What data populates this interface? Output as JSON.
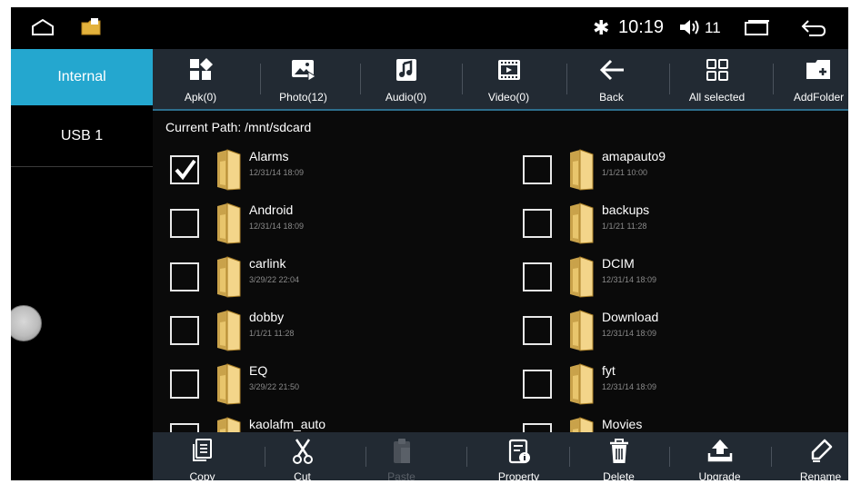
{
  "status_bar": {
    "bluetooth_icon": "bluetooth-icon",
    "time": "10:19",
    "volume_icon": "volume-icon",
    "volume_level": "11",
    "colors": {
      "background": "#000000",
      "text": "#ffffff"
    }
  },
  "sidebar": {
    "items": [
      {
        "label": "Internal",
        "selected": true
      },
      {
        "label": "USB 1",
        "selected": false
      }
    ],
    "accent": "#24a7cf"
  },
  "toolbar": {
    "buttons": [
      {
        "label": "Apk(0)",
        "icon": "apk-icon"
      },
      {
        "label": "Photo(12)",
        "icon": "photo-icon"
      },
      {
        "label": "Audio(0)",
        "icon": "audio-icon"
      },
      {
        "label": "Video(0)",
        "icon": "video-icon"
      },
      {
        "label": "Back",
        "icon": "back-arrow-icon"
      },
      {
        "label": "All selected",
        "icon": "select-all-icon"
      },
      {
        "label": "AddFolder",
        "icon": "add-folder-icon"
      }
    ],
    "background": "#222a33"
  },
  "current_path": "Current Path: /mnt/sdcard",
  "files": [
    {
      "name": "Alarms",
      "date": "12/31/14 18:09",
      "checked": true
    },
    {
      "name": "amapauto9",
      "date": "1/1/21 10:00",
      "checked": false
    },
    {
      "name": "Android",
      "date": "12/31/14 18:09",
      "checked": false
    },
    {
      "name": "backups",
      "date": "1/1/21 11:28",
      "checked": false
    },
    {
      "name": "carlink",
      "date": "3/29/22 22:04",
      "checked": false
    },
    {
      "name": "DCIM",
      "date": "12/31/14 18:09",
      "checked": false
    },
    {
      "name": "dobby",
      "date": "1/1/21 11:28",
      "checked": false
    },
    {
      "name": "Download",
      "date": "12/31/14 18:09",
      "checked": false
    },
    {
      "name": "EQ",
      "date": "3/29/22 21:50",
      "checked": false
    },
    {
      "name": "fyt",
      "date": "12/31/14 18:09",
      "checked": false
    },
    {
      "name": "kaolafm_auto",
      "date": "",
      "checked": false
    },
    {
      "name": "Movies",
      "date": "",
      "checked": false
    }
  ],
  "bottom_bar": {
    "buttons": [
      {
        "label": "Copy",
        "icon": "copy-icon",
        "enabled": true
      },
      {
        "label": "Cut",
        "icon": "cut-icon",
        "enabled": true
      },
      {
        "label": "Paste",
        "icon": "paste-icon",
        "enabled": false
      },
      {
        "label": "Property",
        "icon": "property-icon",
        "enabled": true
      },
      {
        "label": "Delete",
        "icon": "delete-icon",
        "enabled": true
      },
      {
        "label": "Upgrade",
        "icon": "upgrade-icon",
        "enabled": true
      },
      {
        "label": "Rename",
        "icon": "rename-icon",
        "enabled": true
      }
    ]
  }
}
